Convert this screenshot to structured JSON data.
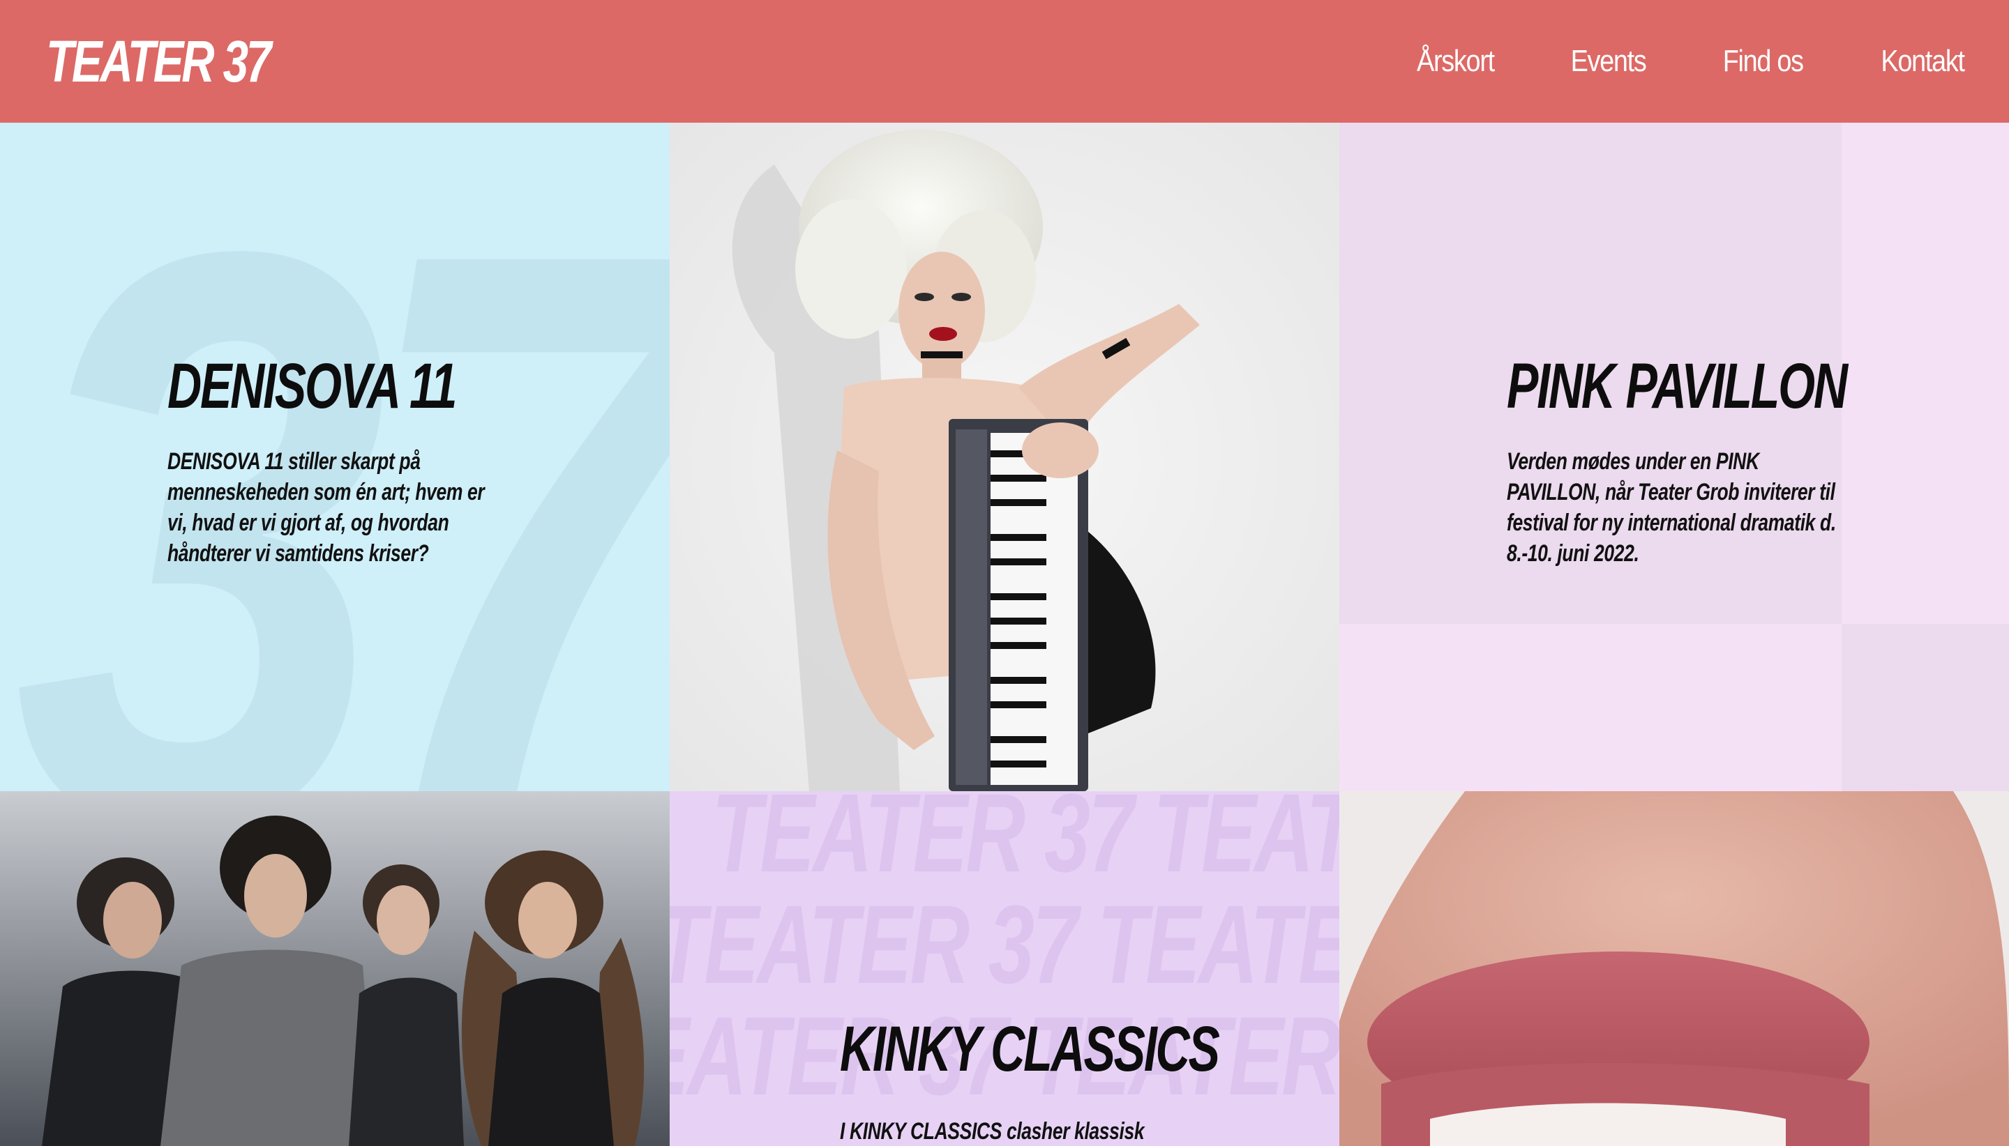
{
  "header": {
    "logo": "TEATER 37",
    "nav": [
      "Årskort",
      "Events",
      "Find os",
      "Kontakt"
    ]
  },
  "tiles": {
    "denisova": {
      "watermark": "37",
      "title": "DENISOVA 11",
      "description": "DENISOVA 11 stiller skarpt på menneskeheden som én art; hvem er vi, hvad er vi gjort af, og hvordan håndterer vi samtidens kriser?"
    },
    "pink_pavillon": {
      "title": "PINK PAVILLON",
      "description": "Verden mødes under en PINK PAVILLON, når Teater Grob inviterer til festival for ny international dramatik d. 8.-10. juni 2022."
    },
    "kinky_classics": {
      "watermark": "TEATER 37  TEATER 37  TEATER 37",
      "title": "KINKY CLASSICS",
      "description": "I KINKY CLASSICS clasher klassisk musik"
    }
  },
  "colors": {
    "header": "#dc6966",
    "tile_blue": "#cfeff9",
    "tile_pink": "#f5e1f6",
    "tile_lilac": "#e7d2f5"
  }
}
